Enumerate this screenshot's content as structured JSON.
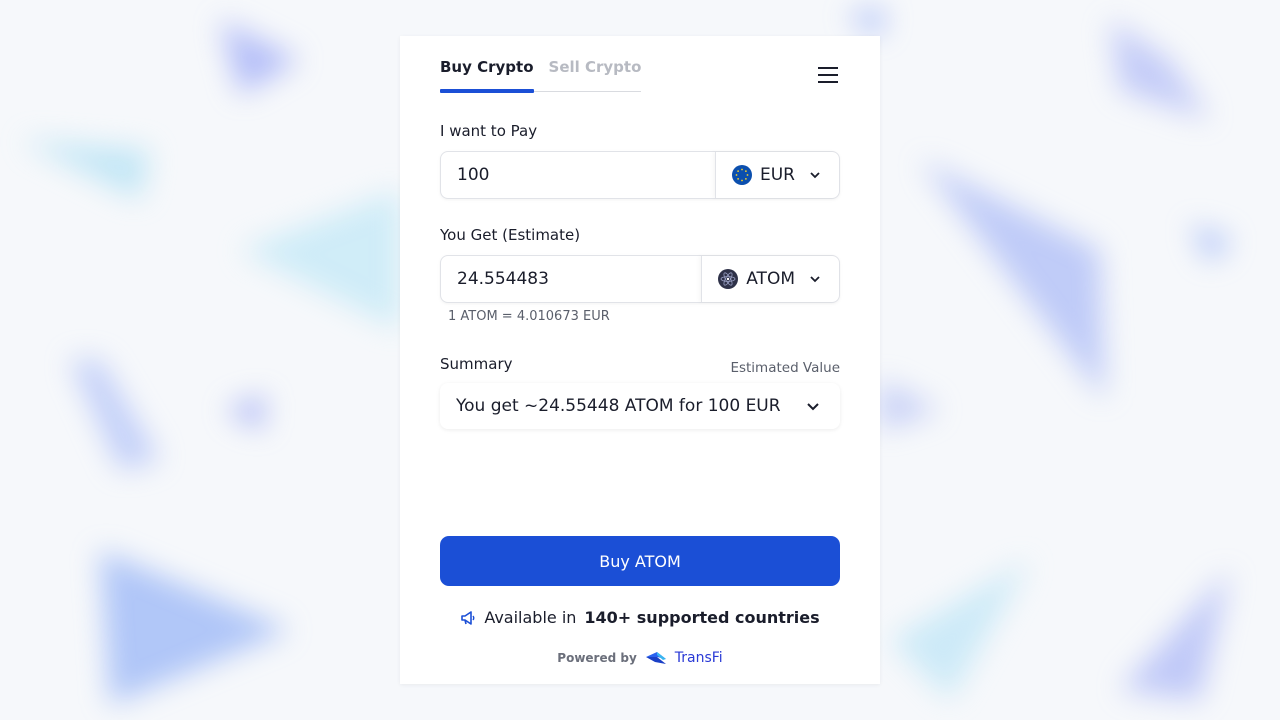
{
  "tabs": {
    "buy": "Buy Crypto",
    "sell": "Sell Crypto"
  },
  "pay": {
    "label": "I want to Pay",
    "amount": "100",
    "currency": "EUR",
    "currency_icon": "euro-flag-icon"
  },
  "get": {
    "label": "You Get (Estimate)",
    "amount": "24.554483",
    "currency": "ATOM",
    "currency_icon": "cosmos-atom-icon",
    "rate": "1 ATOM = 4.010673 EUR"
  },
  "summary": {
    "label": "Summary",
    "estimated_label": "Estimated Value",
    "text": "You get ~24.55448 ATOM for 100 EUR"
  },
  "cta": {
    "buy_label": "Buy ATOM"
  },
  "availability": {
    "prefix": "Available in",
    "bold": "140+ supported countries",
    "icon": "megaphone-icon"
  },
  "footer": {
    "powered_by": "Powered by",
    "brand": "TransFi"
  },
  "colors": {
    "accent": "#1b4fd6",
    "text": "#1a1d2b",
    "muted": "#b7bac2",
    "background": "#f6f8fb"
  }
}
